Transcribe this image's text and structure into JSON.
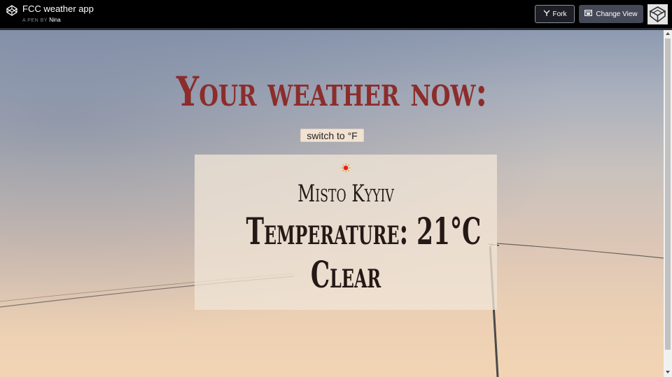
{
  "topbar": {
    "pen_title": "FCC weather app",
    "pen_by_prefix": "A PEN BY",
    "author": "Nina",
    "fork_label": "Fork",
    "change_view_label": "Change View"
  },
  "main": {
    "headline": "Your weather now:",
    "switch_label": "switch to °F",
    "weather_icon": "sun-icon",
    "city": "Misto Kyyiv",
    "temperature": "Temperature: 21°C",
    "condition": "Clear"
  },
  "colors": {
    "headline": "#8b2d2b",
    "card_text": "#241916",
    "topbar": "#000000"
  }
}
